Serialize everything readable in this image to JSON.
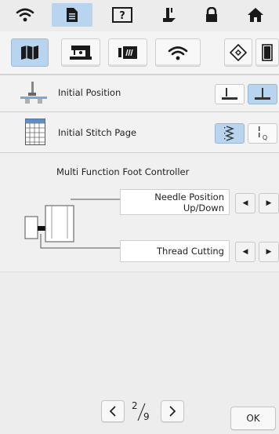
{
  "colors": {
    "active_tab": "#b9d4ef",
    "background": "#f0f0f0"
  },
  "top_tabs": [
    {
      "icon": "wifi-icon"
    },
    {
      "icon": "document-icon",
      "active": true
    },
    {
      "icon": "help-icon",
      "text": "?"
    },
    {
      "icon": "presser-foot-icon"
    },
    {
      "icon": "lock-icon"
    },
    {
      "icon": "home-icon"
    }
  ],
  "secondary_icons": [
    {
      "icon": "settings-book-icon",
      "active": true
    },
    {
      "icon": "sewing-machine-icon"
    },
    {
      "icon": "display-settings-icon"
    },
    {
      "icon": "wlan-icon"
    },
    {
      "icon": "diamond-icon"
    },
    {
      "icon": "frame-icon"
    }
  ],
  "settings": {
    "initial_position": {
      "label": "Initial Position"
    },
    "initial_stitch_page": {
      "label": "Initial Stitch Page"
    }
  },
  "foot_controller": {
    "title": "Multi Function Foot Controller",
    "needle_position": "Needle Position Up/Down",
    "thread_cutting": "Thread Cutting"
  },
  "pagination": {
    "current": "2",
    "total": "9"
  },
  "ok_label": "OK"
}
